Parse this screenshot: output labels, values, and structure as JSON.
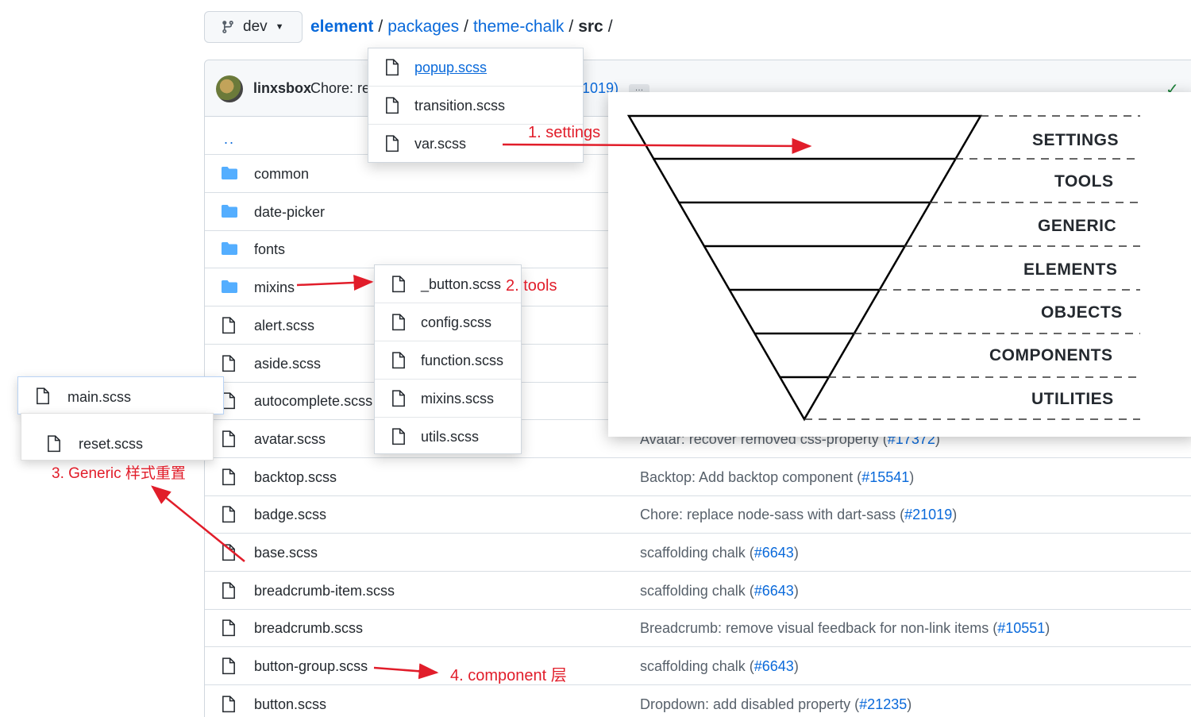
{
  "branch": {
    "name": "dev"
  },
  "breadcrumb": {
    "repo": "element",
    "parts": [
      "packages",
      "theme-chalk"
    ],
    "current": "src",
    "sep": "/"
  },
  "commit": {
    "author": "linxsbox",
    "message": "Chore: re",
    "tail": "1019)",
    "ellipsis": "…"
  },
  "parent_dir": "..",
  "rows": [
    {
      "name": "common",
      "type": "folder"
    },
    {
      "name": "date-picker",
      "type": "folder"
    },
    {
      "name": "fonts",
      "type": "folder"
    },
    {
      "name": "mixins",
      "type": "folder"
    },
    {
      "name": "alert.scss",
      "type": "file"
    },
    {
      "name": "aside.scss",
      "type": "file"
    },
    {
      "name": "autocomplete.scss",
      "type": "file"
    },
    {
      "name": "avatar.scss",
      "type": "file",
      "msg": "Avatar: recover removed css-property (",
      "pr": "#17372",
      "end": ")"
    },
    {
      "name": "backtop.scss",
      "type": "file",
      "msg": "Backtop: Add backtop component (",
      "pr": "#15541",
      "end": ")"
    },
    {
      "name": "badge.scss",
      "type": "file",
      "msg": "Chore: replace node-sass with dart-sass (",
      "pr": "#21019",
      "end": ")"
    },
    {
      "name": "base.scss",
      "type": "file",
      "msg": "scaffolding chalk (",
      "pr": "#6643",
      "end": ")"
    },
    {
      "name": "breadcrumb-item.scss",
      "type": "file",
      "msg": "scaffolding chalk (",
      "pr": "#6643",
      "end": ")"
    },
    {
      "name": "breadcrumb.scss",
      "type": "file",
      "msg": "Breadcrumb: remove visual feedback for non-link items (",
      "pr": "#10551",
      "end": ")"
    },
    {
      "name": "button-group.scss",
      "type": "file",
      "msg": "scaffolding chalk (",
      "pr": "#6643",
      "end": ")"
    },
    {
      "name": "button.scss",
      "type": "file",
      "msg": "Dropdown: add disabled property (",
      "pr": "#21235",
      "end": ")"
    }
  ],
  "popup_settings": [
    "popup.scss",
    "transition.scss",
    "var.scss"
  ],
  "popup_tools": [
    "_button.scss",
    "config.scss",
    "function.scss",
    "mixins.scss",
    "utils.scss"
  ],
  "popup_generic": [
    "main.scss",
    "reset.scss"
  ],
  "annotations": {
    "settings": "1. settings",
    "tools": "2. tools",
    "generic": "3. Generic 样式重置",
    "component": "4. component 层"
  },
  "pyramid_levels": [
    "SETTINGS",
    "TOOLS",
    "GENERIC",
    "ELEMENTS",
    "OBJECTS",
    "COMPONENTS",
    "UTILITIES"
  ],
  "colors": {
    "link": "#0969da",
    "annotation": "#e11d2a",
    "folder": "#54aeff",
    "check": "#1a7f37"
  },
  "icons": {
    "branch": "git-branch-icon",
    "folder": "folder-icon",
    "file": "file-icon",
    "check": "check-icon"
  }
}
